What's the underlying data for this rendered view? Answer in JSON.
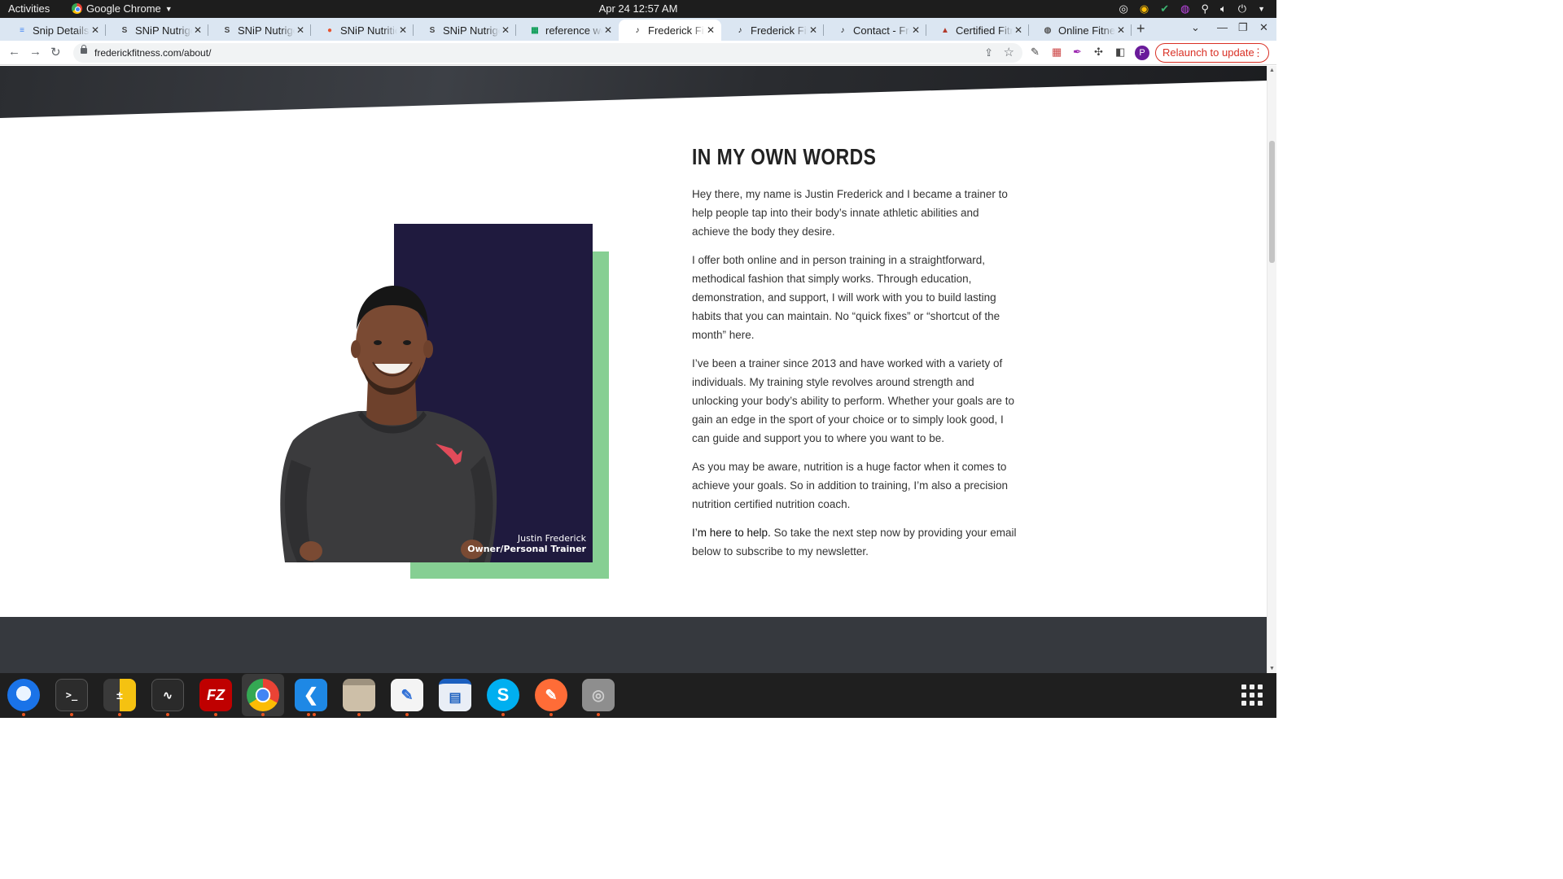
{
  "system": {
    "activities": "Activities",
    "app_name": "Google Chrome",
    "clock": "Apr 24  12:57 AM"
  },
  "browser": {
    "tabs": [
      {
        "title": "Snip Details -",
        "icon": "doc-icon",
        "color": "#4285f4"
      },
      {
        "title": "SNiP Nutrige",
        "icon": "snip-icon",
        "color": "#444444"
      },
      {
        "title": "SNiP Nutrige",
        "icon": "snip-icon",
        "color": "#444444"
      },
      {
        "title": "SNiP Nutritio",
        "icon": "snip-color-icon",
        "color": "#e8532f"
      },
      {
        "title": "SNiP Nutrige",
        "icon": "snip-icon",
        "color": "#444444"
      },
      {
        "title": "reference we",
        "icon": "sheets-icon",
        "color": "#0f9d58"
      },
      {
        "title": "Frederick Fit",
        "icon": "ff-icon",
        "color": "#111111",
        "active": true
      },
      {
        "title": "Frederick Fit",
        "icon": "ff-icon",
        "color": "#111111"
      },
      {
        "title": "Contact - Fre",
        "icon": "ff-icon",
        "color": "#111111"
      },
      {
        "title": "Certified Fitn",
        "icon": "cert-icon",
        "color": "#b23a2c"
      },
      {
        "title": "Online Fitnes",
        "icon": "globe-icon",
        "color": "#555555"
      }
    ],
    "url": "frederickfitness.com/about/",
    "relaunch_label": "Relaunch to update",
    "profile_initial": "P"
  },
  "page": {
    "heading": "IN MY OWN WORDS",
    "paragraphs": [
      "Hey there, my name is Justin Frederick and I became a trainer to help people tap into their body’s innate athletic abilities and achieve the body they desire.",
      "I offer both online and in person training in a straightforward, methodical fashion that simply works. Through education, demonstration, and support, I will work with you to build lasting habits that you can maintain. No “quick fixes” or “shortcut of the month” here.",
      "I’ve been a trainer since 2013 and have worked with a variety of individuals. My training style revolves around strength and unlocking your body’s ability to perform. Whether your goals are to gain an edge in the sport of your choice or to simply look good, I can guide and support you to where you want to be.",
      "As you may be aware, nutrition is a huge factor when it comes to achieve your goals. So in addition to training, I’m also a precision nutrition certified nutrition coach."
    ],
    "cta_strong": "I’m here to help.",
    "cta_rest": " So take the next step now by providing your email below to subscribe to my newsletter.",
    "caption_name": "Justin Frederick",
    "caption_role": "Owner/Personal Trainer",
    "colors": {
      "navy": "#1f1a3e",
      "green": "#86cf93",
      "footer": "#36393e"
    }
  },
  "dock": {
    "apps": [
      {
        "name": "thunderbird-icon"
      },
      {
        "name": "terminal-icon"
      },
      {
        "name": "calculator-icon"
      },
      {
        "name": "system-monitor-icon"
      },
      {
        "name": "filezilla-icon"
      },
      {
        "name": "chrome-icon"
      },
      {
        "name": "vscode-icon"
      },
      {
        "name": "files-icon"
      },
      {
        "name": "text-editor-icon"
      },
      {
        "name": "document-viewer-icon"
      },
      {
        "name": "skype-icon"
      },
      {
        "name": "postman-icon"
      },
      {
        "name": "disk-icon"
      }
    ]
  }
}
